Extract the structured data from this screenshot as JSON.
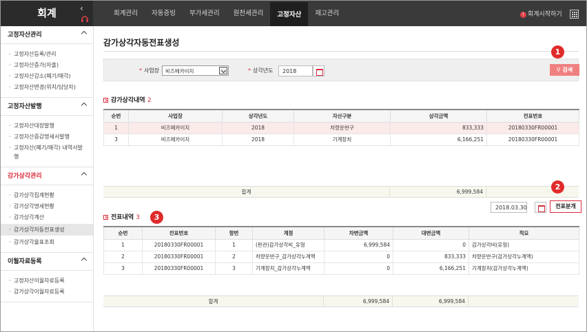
{
  "app": {
    "logo": "회계",
    "collapse_glyph": "‹"
  },
  "nav": {
    "items": [
      "회계관리",
      "자동증빙",
      "부가세관리",
      "원천세관리",
      "고정자산",
      "재고관리"
    ],
    "active": "고정자산"
  },
  "header": {
    "start_label": "회계시작하기",
    "start_glyph": "!"
  },
  "sidebar": {
    "sections": [
      {
        "title": "고정자산관리",
        "items": [
          "고정자산등록/관리",
          "고정자산증가(자출)",
          "고정자산감소(폐기/매각)",
          "고정자산변경(위치/담당자)"
        ]
      },
      {
        "title": "고정자산발행",
        "items": [
          "고정자산대장발행",
          "고정자산증감명세서발행",
          "고정자산(폐기/매각) 내역서발행"
        ]
      },
      {
        "title": "감가상각관리",
        "items": [
          "감가상각집계현황",
          "감가상각명세현황",
          "감가상각계산",
          "감가상각자동전표생성",
          "감가상각율표조회"
        ]
      },
      {
        "title": "이월자료등록",
        "items": [
          "고정자산이월자료등록",
          "감가상각이월자료등록"
        ]
      }
    ]
  },
  "page": {
    "title": "감가상각자동전표생성"
  },
  "search": {
    "business_label": "사업장",
    "business_value": "비즈메카이지",
    "year_label": "상각년도",
    "year_value": "2018",
    "search_button": "검색"
  },
  "depreciation": {
    "title": "감가상각내역",
    "count": "2",
    "columns": [
      "순번",
      "사업장",
      "상각년도",
      "자산구분",
      "상각금액",
      "전표번호"
    ],
    "rows": [
      [
        "1",
        "비즈메카이지",
        "2018",
        "차량운반구",
        "833,333",
        "20180330FR00001"
      ],
      [
        "3",
        "비즈메카이지",
        "2018",
        "기계장치",
        "6,166,251",
        "20180330FR00001"
      ]
    ],
    "total_label": "합계",
    "total_amount": "6,999,584"
  },
  "voucher_action": {
    "date": "2018.03.30",
    "split_button": "전표분개"
  },
  "voucher": {
    "title": "전표내역",
    "count": "3",
    "columns": [
      "순번",
      "전표번호",
      "항번",
      "계정",
      "차변금액",
      "대변금액",
      "적요"
    ],
    "rows": [
      [
        "1",
        "20180330FR00001",
        "1",
        "(판관)감가상각비_유형",
        "6,999,584",
        "0",
        "감가상각비(유형)"
      ],
      [
        "2",
        "20180330FR00001",
        "2",
        "차량운반구_감가상각누계액",
        "0",
        "833,333",
        "차량운반구(감가상각누계액)"
      ],
      [
        "3",
        "20180330FR00001",
        "3",
        "기계장치_감가상각누계액",
        "0",
        "6,166,251",
        "기계장치(감가상각누계액)"
      ]
    ],
    "total_label": "합계",
    "total_debit": "6,999,584",
    "total_credit": "6,999,584"
  },
  "markers": [
    "1",
    "2",
    "3"
  ]
}
